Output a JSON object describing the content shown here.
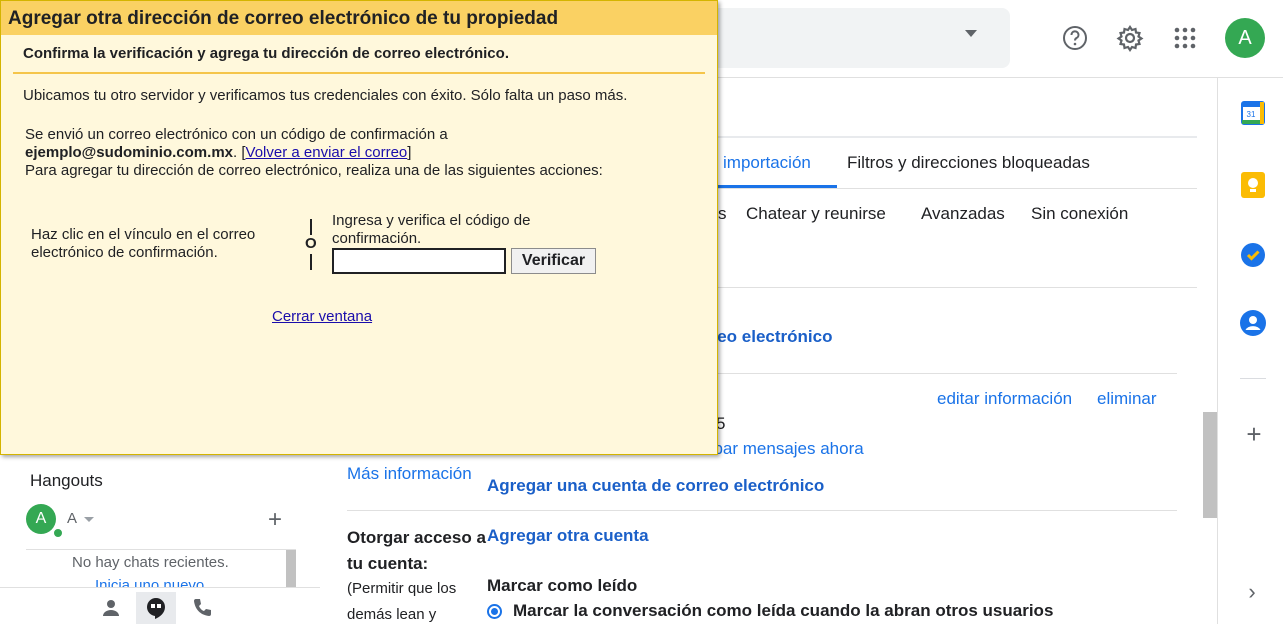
{
  "dialog": {
    "title": "Agregar otra dirección de correo electrónico de tu propiedad",
    "subtitle": "Confirma la verificación y agrega tu dirección de correo electrónico.",
    "success_text": "Ubicamos tu otro servidor y verificamos tus credenciales con éxito. Sólo falta un paso más.",
    "sent_text": "Se envió un correo electrónico con un código de confirmación a",
    "email": "ejemplo@sudominio.com.mx",
    "resend_link": "Volver a enviar el correo",
    "instruction": "Para agregar tu dirección de correo electrónico, realiza una de las siguientes acciones:",
    "option_link_text": "Haz clic en el vínculo en el correo electrónico de confirmación.",
    "or_text": "O",
    "option_code_text": "Ingresa y verifica el código de confirmación.",
    "code_value": "",
    "verify_button": "Verificar",
    "close_link": "Cerrar ventana"
  },
  "settings": {
    "tabs": {
      "import": "importación",
      "filters": "Filtros y direcciones bloqueadas",
      "partial_s": "s",
      "chat": "Chatear y reunirse",
      "advanced": "Avanzadas",
      "offline": "Sin conexión"
    },
    "add_email_link": "rreo electrónico",
    "edit_info_link": "editar información",
    "delete_link": "eliminar",
    "partial_number": "5",
    "check_mail_link": "obar mensajes ahora",
    "more_info_link": "Más información",
    "add_account_link": "Agregar una cuenta de correo electrónico",
    "grant_access_title": "Otorgar acceso a tu cuenta:",
    "grant_access_desc": "(Permitir que los demás lean y",
    "add_other_account_link": "Agregar otra cuenta",
    "mark_read_title": "Marcar como leído",
    "mark_read_option": "Marcar la conversación como leída cuando la abran otros usuarios"
  },
  "header": {
    "avatar_letter": "A"
  },
  "hangouts": {
    "title": "Hangouts",
    "avatar_letter": "A",
    "user_name": "A",
    "no_chats": "No hay chats recientes.",
    "start_new": "Inicia uno nuevo"
  },
  "side_panel": {
    "calendar_day": "31"
  },
  "colors": {
    "accent": "#1a73e8",
    "dialog_header": "#fad163",
    "dialog_bg": "#fff8dc",
    "avatar": "#34a853"
  }
}
